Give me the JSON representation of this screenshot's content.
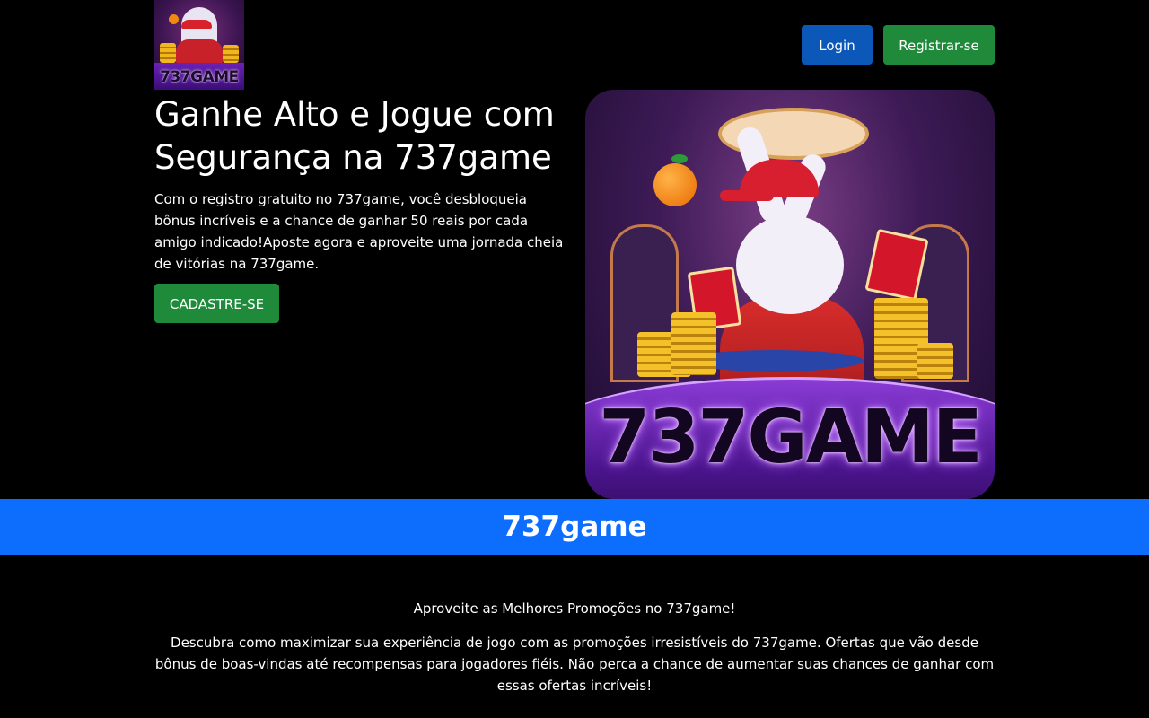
{
  "header": {
    "logo_text": "737GAME",
    "login_label": "Login",
    "register_label": "Registrar-se"
  },
  "hero": {
    "title": "Ganhe Alto e Jogue com Segurança na 737game",
    "description": "Com o registro gratuito no 737game, você desbloqueia bônus incríveis e a chance de ganhar 50 reais por cada amigo indicado!Aposte agora e aproveite uma jornada cheia de vitórias na 737game.",
    "cta_label": "CADASTRE-SE",
    "image_brand_text": "737GAME"
  },
  "banner": {
    "title": "737game"
  },
  "promo": {
    "heading": "Aproveite as Melhores Promoções no 737game!",
    "text": "Descubra como maximizar sua experiência de jogo com as promoções irresistíveis do 737game. Ofertas que vão desde bônus de boas-vindas até recompensas para jogadores fiéis. Não perca a chance de aumentar suas chances de ganhar com essas ofertas incríveis!"
  },
  "colors": {
    "background": "#000000",
    "login_button": "#0b58b8",
    "register_button": "#1f8b3a",
    "banner": "#0d6efd"
  }
}
